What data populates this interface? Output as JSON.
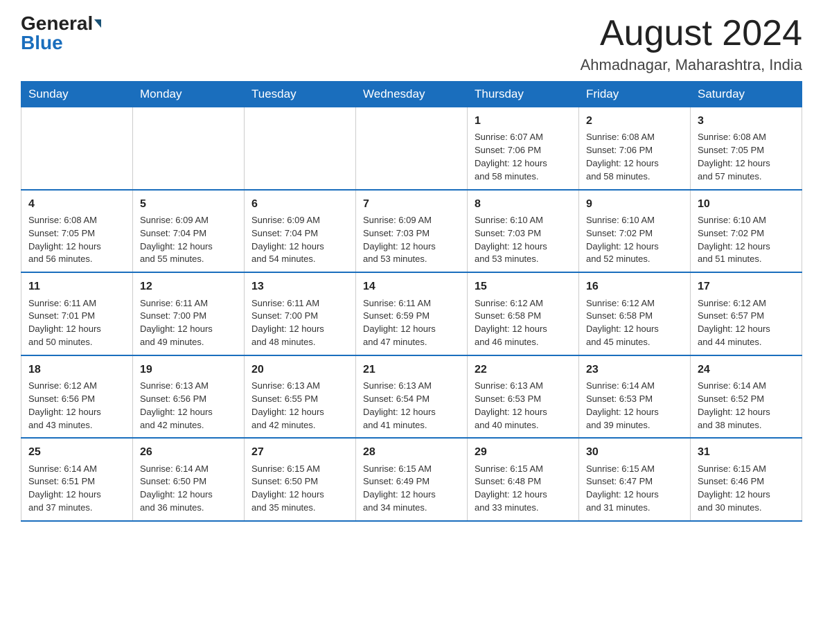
{
  "logo": {
    "general": "General",
    "blue": "Blue"
  },
  "header": {
    "month_year": "August 2024",
    "location": "Ahmadnagar, Maharashtra, India"
  },
  "days_of_week": [
    "Sunday",
    "Monday",
    "Tuesday",
    "Wednesday",
    "Thursday",
    "Friday",
    "Saturday"
  ],
  "weeks": [
    [
      {
        "day": "",
        "info": ""
      },
      {
        "day": "",
        "info": ""
      },
      {
        "day": "",
        "info": ""
      },
      {
        "day": "",
        "info": ""
      },
      {
        "day": "1",
        "info": "Sunrise: 6:07 AM\nSunset: 7:06 PM\nDaylight: 12 hours\nand 58 minutes."
      },
      {
        "day": "2",
        "info": "Sunrise: 6:08 AM\nSunset: 7:06 PM\nDaylight: 12 hours\nand 58 minutes."
      },
      {
        "day": "3",
        "info": "Sunrise: 6:08 AM\nSunset: 7:05 PM\nDaylight: 12 hours\nand 57 minutes."
      }
    ],
    [
      {
        "day": "4",
        "info": "Sunrise: 6:08 AM\nSunset: 7:05 PM\nDaylight: 12 hours\nand 56 minutes."
      },
      {
        "day": "5",
        "info": "Sunrise: 6:09 AM\nSunset: 7:04 PM\nDaylight: 12 hours\nand 55 minutes."
      },
      {
        "day": "6",
        "info": "Sunrise: 6:09 AM\nSunset: 7:04 PM\nDaylight: 12 hours\nand 54 minutes."
      },
      {
        "day": "7",
        "info": "Sunrise: 6:09 AM\nSunset: 7:03 PM\nDaylight: 12 hours\nand 53 minutes."
      },
      {
        "day": "8",
        "info": "Sunrise: 6:10 AM\nSunset: 7:03 PM\nDaylight: 12 hours\nand 53 minutes."
      },
      {
        "day": "9",
        "info": "Sunrise: 6:10 AM\nSunset: 7:02 PM\nDaylight: 12 hours\nand 52 minutes."
      },
      {
        "day": "10",
        "info": "Sunrise: 6:10 AM\nSunset: 7:02 PM\nDaylight: 12 hours\nand 51 minutes."
      }
    ],
    [
      {
        "day": "11",
        "info": "Sunrise: 6:11 AM\nSunset: 7:01 PM\nDaylight: 12 hours\nand 50 minutes."
      },
      {
        "day": "12",
        "info": "Sunrise: 6:11 AM\nSunset: 7:00 PM\nDaylight: 12 hours\nand 49 minutes."
      },
      {
        "day": "13",
        "info": "Sunrise: 6:11 AM\nSunset: 7:00 PM\nDaylight: 12 hours\nand 48 minutes."
      },
      {
        "day": "14",
        "info": "Sunrise: 6:11 AM\nSunset: 6:59 PM\nDaylight: 12 hours\nand 47 minutes."
      },
      {
        "day": "15",
        "info": "Sunrise: 6:12 AM\nSunset: 6:58 PM\nDaylight: 12 hours\nand 46 minutes."
      },
      {
        "day": "16",
        "info": "Sunrise: 6:12 AM\nSunset: 6:58 PM\nDaylight: 12 hours\nand 45 minutes."
      },
      {
        "day": "17",
        "info": "Sunrise: 6:12 AM\nSunset: 6:57 PM\nDaylight: 12 hours\nand 44 minutes."
      }
    ],
    [
      {
        "day": "18",
        "info": "Sunrise: 6:12 AM\nSunset: 6:56 PM\nDaylight: 12 hours\nand 43 minutes."
      },
      {
        "day": "19",
        "info": "Sunrise: 6:13 AM\nSunset: 6:56 PM\nDaylight: 12 hours\nand 42 minutes."
      },
      {
        "day": "20",
        "info": "Sunrise: 6:13 AM\nSunset: 6:55 PM\nDaylight: 12 hours\nand 42 minutes."
      },
      {
        "day": "21",
        "info": "Sunrise: 6:13 AM\nSunset: 6:54 PM\nDaylight: 12 hours\nand 41 minutes."
      },
      {
        "day": "22",
        "info": "Sunrise: 6:13 AM\nSunset: 6:53 PM\nDaylight: 12 hours\nand 40 minutes."
      },
      {
        "day": "23",
        "info": "Sunrise: 6:14 AM\nSunset: 6:53 PM\nDaylight: 12 hours\nand 39 minutes."
      },
      {
        "day": "24",
        "info": "Sunrise: 6:14 AM\nSunset: 6:52 PM\nDaylight: 12 hours\nand 38 minutes."
      }
    ],
    [
      {
        "day": "25",
        "info": "Sunrise: 6:14 AM\nSunset: 6:51 PM\nDaylight: 12 hours\nand 37 minutes."
      },
      {
        "day": "26",
        "info": "Sunrise: 6:14 AM\nSunset: 6:50 PM\nDaylight: 12 hours\nand 36 minutes."
      },
      {
        "day": "27",
        "info": "Sunrise: 6:15 AM\nSunset: 6:50 PM\nDaylight: 12 hours\nand 35 minutes."
      },
      {
        "day": "28",
        "info": "Sunrise: 6:15 AM\nSunset: 6:49 PM\nDaylight: 12 hours\nand 34 minutes."
      },
      {
        "day": "29",
        "info": "Sunrise: 6:15 AM\nSunset: 6:48 PM\nDaylight: 12 hours\nand 33 minutes."
      },
      {
        "day": "30",
        "info": "Sunrise: 6:15 AM\nSunset: 6:47 PM\nDaylight: 12 hours\nand 31 minutes."
      },
      {
        "day": "31",
        "info": "Sunrise: 6:15 AM\nSunset: 6:46 PM\nDaylight: 12 hours\nand 30 minutes."
      }
    ]
  ]
}
